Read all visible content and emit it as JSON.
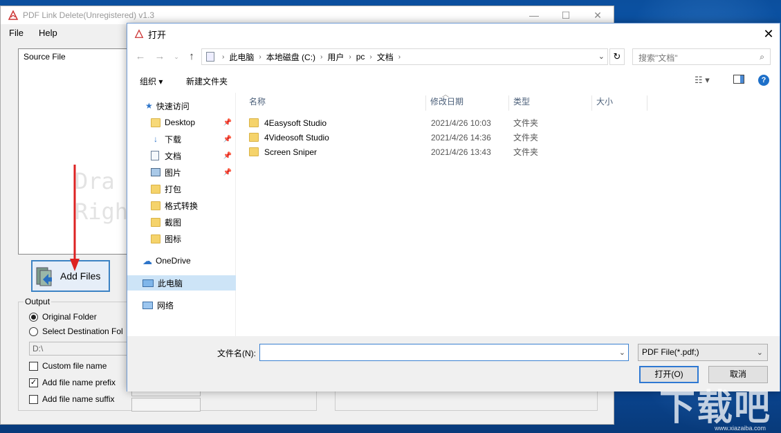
{
  "app": {
    "title": "PDF Link Delete(Unregistered) v1.3",
    "menu": [
      "File",
      "Help"
    ],
    "source_label": "Source File",
    "drag_hint_line1": "Dra",
    "drag_hint_line2": "Righ",
    "add_files_label": "Add Files",
    "output_title": "Output",
    "opt_original_folder": "Original Folder",
    "opt_select_destination": "Select Destination Fol",
    "path_value": "D:\\",
    "opt_custom_name": "Custom file name",
    "opt_prefix": "Add file name prefix",
    "opt_suffix": "Add file name suffix"
  },
  "dialog": {
    "title": "打开",
    "address": [
      "此电脑",
      "本地磁盘 (C:)",
      "用户",
      "pc",
      "文档"
    ],
    "search_placeholder": "搜索\"文档\"",
    "toolbar": {
      "organize": "组织 ▾",
      "new_folder": "新建文件夹"
    },
    "sidebar": {
      "quick_access": "快速访问",
      "items": [
        "Desktop",
        "下载",
        "文档",
        "图片",
        "打包",
        "格式转换",
        "截图",
        "图标"
      ],
      "onedrive": "OneDrive",
      "this_pc": "此电脑",
      "network": "网络"
    },
    "columns": [
      "名称",
      "修改日期",
      "类型",
      "大小"
    ],
    "files": [
      {
        "name": "4Easysoft Studio",
        "date": "2021/4/26 10:03",
        "type": "文件夹"
      },
      {
        "name": "4Videosoft Studio",
        "date": "2021/4/26 14:36",
        "type": "文件夹"
      },
      {
        "name": "Screen Sniper",
        "date": "2021/4/26 13:43",
        "type": "文件夹"
      }
    ],
    "filename_label": "文件名(N):",
    "filename_value": "",
    "filter_selected": "PDF File(*.pdf;)",
    "open_button": "打开(O)",
    "cancel_button": "取消"
  },
  "watermark": {
    "text": "下载吧",
    "url": "www.xiazaiba.com"
  },
  "colors": {
    "accent": "#1e70c9",
    "selection": "#cde4f7",
    "desktop": "#0a5fc2"
  }
}
